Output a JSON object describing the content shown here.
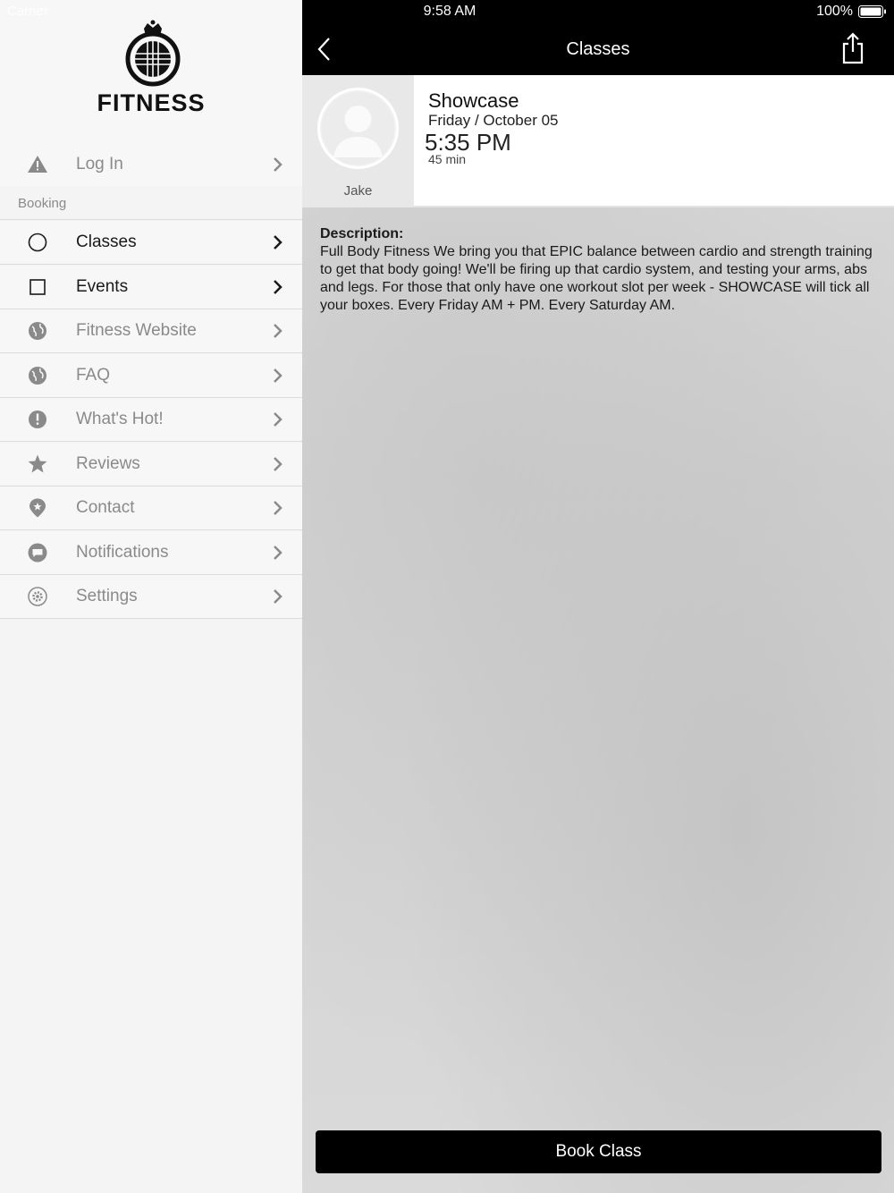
{
  "status_bar": {
    "time": "9:58 AM",
    "battery": "100%",
    "carrier": "Carrier"
  },
  "brand": {
    "name": "FITNESS"
  },
  "sidebar": {
    "login": {
      "label": "Log In",
      "icon": "warning-icon"
    },
    "section_label": "Booking",
    "items": [
      {
        "label": "Classes",
        "icon": "circle-icon",
        "active": true
      },
      {
        "label": "Events",
        "icon": "square-icon",
        "active": true
      },
      {
        "label": "Fitness Website",
        "icon": "globe-icon",
        "active": false
      },
      {
        "label": "FAQ",
        "icon": "globe-icon",
        "active": false
      },
      {
        "label": "What's Hot!",
        "icon": "exclamation-icon",
        "active": false
      },
      {
        "label": "Reviews",
        "icon": "star-icon",
        "active": false
      },
      {
        "label": "Contact",
        "icon": "location-pin-icon",
        "active": false
      },
      {
        "label": "Notifications",
        "icon": "chat-bubble-icon",
        "active": false
      },
      {
        "label": "Settings",
        "icon": "gear-icon",
        "active": false
      }
    ]
  },
  "navbar": {
    "title": "Classes"
  },
  "class_detail": {
    "name": "Showcase",
    "date": "Friday / October 05",
    "time": "5:35 PM",
    "duration": "45 min",
    "instructor": "Jake",
    "description_heading": "Description:",
    "description": "Full Body Fitness We bring you that EPIC balance between cardio and strength training to get that body going! We'll be firing up that cardio system, and testing your arms, abs and legs.  For those that only have one workout slot per week - SHOWCASE will tick all your boxes.    Every Friday AM + PM.  Every Saturday AM."
  },
  "actions": {
    "book_label": "Book Class"
  }
}
